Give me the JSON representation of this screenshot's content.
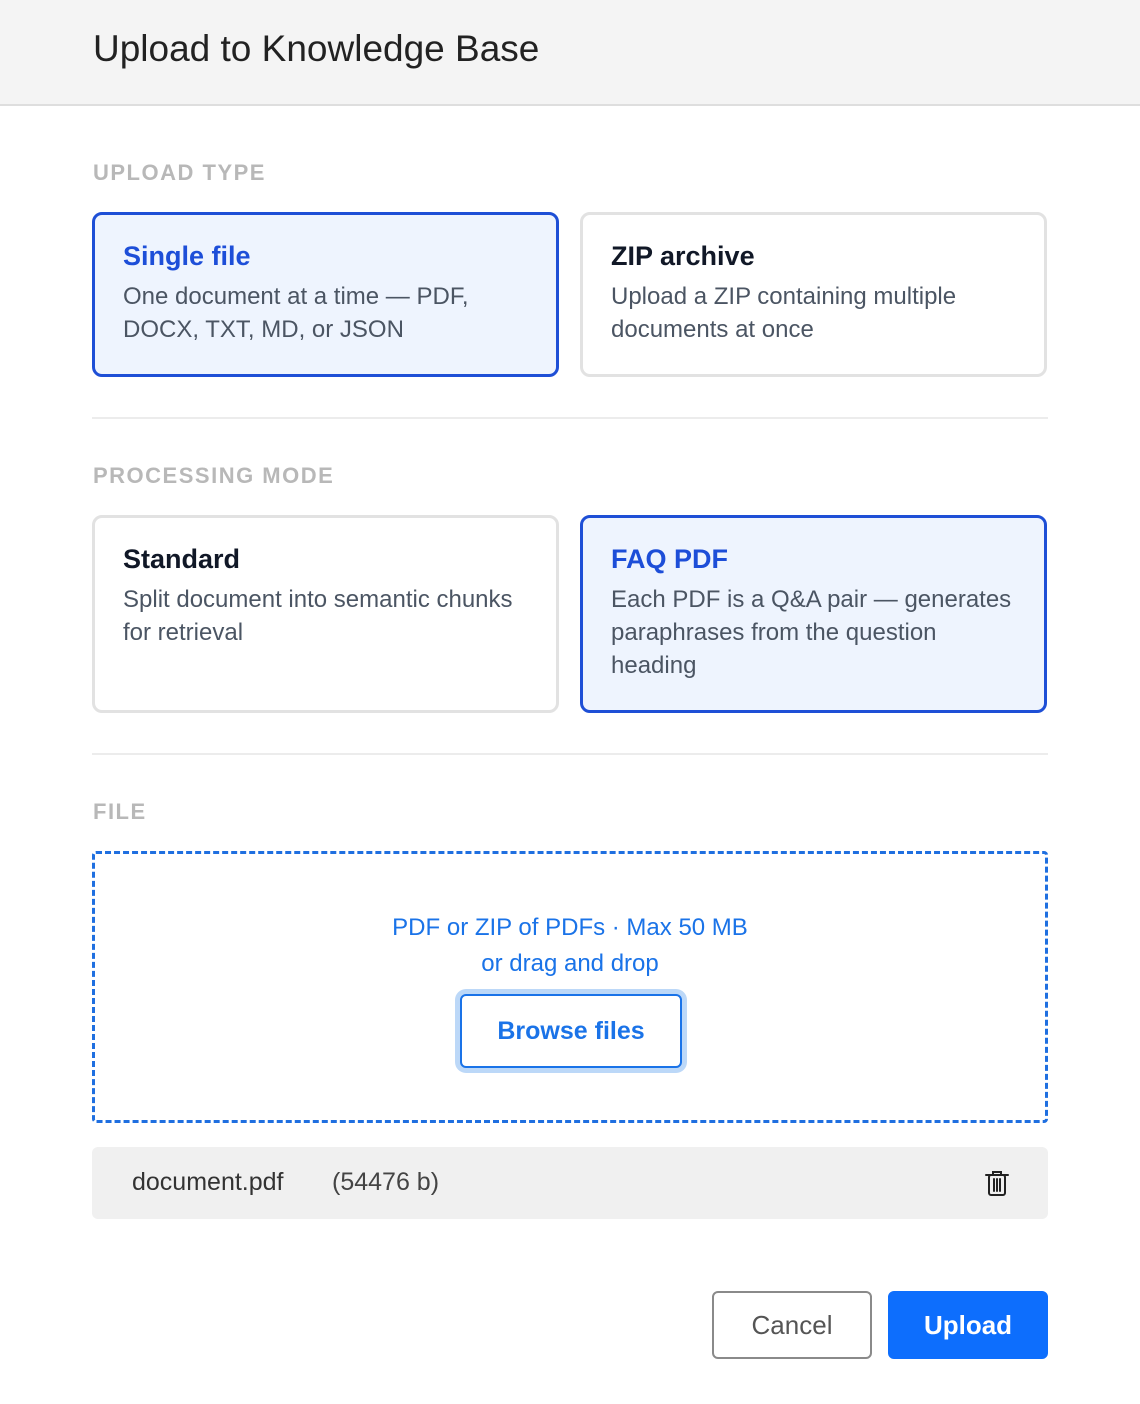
{
  "dialog": {
    "title": "Upload to Knowledge Base"
  },
  "upload_type": {
    "label": "UPLOAD TYPE",
    "options": [
      {
        "title": "Single file",
        "description": "One document at a time — PDF, DOCX, TXT, MD, or JSON",
        "selected": true
      },
      {
        "title": "ZIP archive",
        "description": "Upload a ZIP containing multiple documents at once",
        "selected": false
      }
    ]
  },
  "processing_mode": {
    "label": "PROCESSING MODE",
    "options": [
      {
        "title": "Standard",
        "description": "Split document into semantic chunks for retrieval",
        "selected": false
      },
      {
        "title": "FAQ PDF",
        "description": "Each PDF is a Q&A pair — generates paraphrases from the question heading",
        "selected": true
      }
    ]
  },
  "file": {
    "label": "FILE",
    "dropzone": {
      "hint": "PDF or ZIP of PDFs · Max 50 MB",
      "drag_text": "or drag and drop",
      "browse_label": "Browse files"
    },
    "selected_file": {
      "name": "document.pdf",
      "size": "(54476 b)",
      "remove_icon": "trash-icon"
    }
  },
  "actions": {
    "cancel_label": "Cancel",
    "upload_label": "Upload"
  },
  "colors": {
    "accent": "#1e4fd6",
    "link": "#1a73e8",
    "primary_button": "#0d6efd",
    "selected_card_bg": "#eef4fe"
  }
}
